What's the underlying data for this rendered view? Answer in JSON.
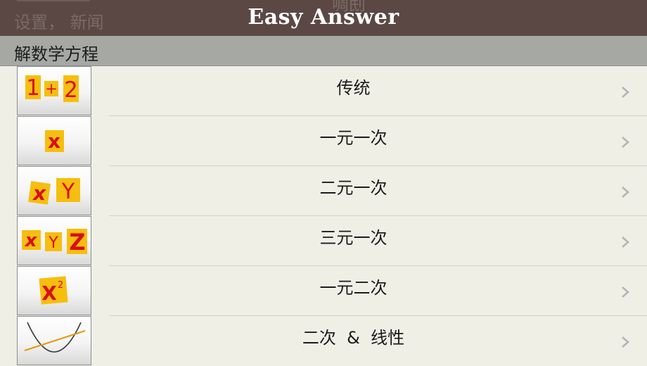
{
  "app": {
    "title": "Easy Answer",
    "background_text": "设置， 新闻",
    "background_text_right": "啁刡"
  },
  "section": {
    "title": "解数学方程"
  },
  "rows": [
    {
      "label": "传统",
      "icon": "one-plus-two-icon",
      "icon_text": [
        "1",
        "+",
        "2"
      ]
    },
    {
      "label": "一元一次",
      "icon": "x-icon",
      "icon_text": [
        "x"
      ]
    },
    {
      "label": "二元一次",
      "icon": "x-y-icon",
      "icon_text": [
        "x",
        "Y"
      ]
    },
    {
      "label": "三元一次",
      "icon": "x-y-z-icon",
      "icon_text": [
        "x",
        "Y",
        "Z"
      ]
    },
    {
      "label": "一元二次",
      "icon": "x-squared-icon",
      "icon_text": [
        "X",
        "2"
      ]
    },
    {
      "label": "二次  &  线性",
      "icon": "parabola-line-icon"
    }
  ],
  "colors": {
    "navbar": "#5b4844",
    "section_bar": "#a5a8a3",
    "background": "#f0efe6",
    "tile": "#f6be0e",
    "symbol": "#d80f16",
    "chevron": "#b4b4b4"
  }
}
